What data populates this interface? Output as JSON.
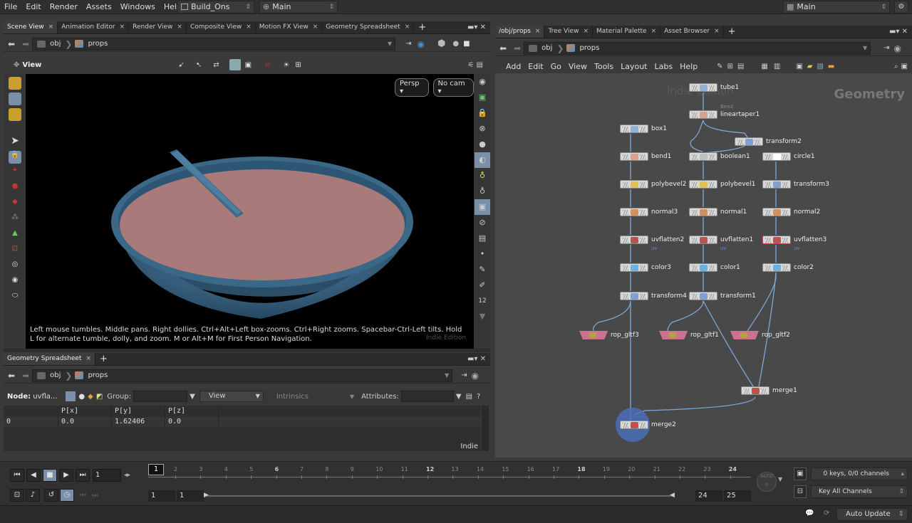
{
  "menubar": {
    "items": [
      "File",
      "Edit",
      "Render",
      "Assets",
      "Windows",
      "Help"
    ],
    "desktop": "Build_Ons",
    "context": "Main",
    "right_context": "Main"
  },
  "left_pane": {
    "tabs": [
      "Scene View",
      "Animation Editor",
      "Render View",
      "Composite View",
      "Motion FX View",
      "Geometry Spreadsheet"
    ],
    "path": [
      "obj",
      "props"
    ],
    "view_label": "View",
    "persp_button": "Persp",
    "cam_button": "No cam",
    "hint": "Left mouse tumbles. Middle pans. Right dollies. Ctrl+Alt+Left box-zooms. Ctrl+Right zooms. Spacebar-Ctrl-Left tilts. Hold L for alternate tumble, dolly, and zoom.     M or Alt+M for First Person Navigation.",
    "watermark": "Indie Edition"
  },
  "spreadsheet": {
    "tab": "Geometry Spreadsheet",
    "path": [
      "obj",
      "props"
    ],
    "node_label": "Node:",
    "node_value": "uvfla...",
    "group_label": "Group:",
    "view_label": "View",
    "intrinsics_label": "Intrinsics",
    "attributes_label": "Attributes:",
    "columns": [
      "",
      "P[x]",
      "P[y]",
      "P[z]"
    ],
    "rows": [
      [
        "0",
        "0.0",
        "1.62406",
        "0.0"
      ]
    ],
    "footer": "Indie"
  },
  "right_pane": {
    "tabs": [
      "/obj/props",
      "Tree View",
      "Material Palette",
      "Asset Browser"
    ],
    "path": [
      "obj",
      "props"
    ],
    "menu": [
      "Add",
      "Edit",
      "Go",
      "View",
      "Tools",
      "Layout",
      "Labs",
      "Help"
    ],
    "watermark": "Indie Edition",
    "context_label": "Geometry"
  },
  "network": {
    "nodes": [
      {
        "id": "tube1",
        "label": "tube1",
        "sub": "",
        "color": "#8fb0d8"
      },
      {
        "id": "lineartaper1",
        "label": "lineartaper1",
        "sub": "Bend",
        "color": "#d8a08f"
      },
      {
        "id": "transform2",
        "label": "transform2",
        "sub": "",
        "color": "#7fa0d0"
      },
      {
        "id": "box1",
        "label": "box1",
        "sub": "",
        "color": "#8fb0d8"
      },
      {
        "id": "bend1",
        "label": "bend1",
        "sub": "",
        "color": "#d8a08f"
      },
      {
        "id": "boolean1",
        "label": "boolean1",
        "sub": "",
        "color": "#c0c0c0"
      },
      {
        "id": "circle1",
        "label": "circle1",
        "sub": "",
        "color": "#ffffff"
      },
      {
        "id": "polybevel2",
        "label": "polybevel2",
        "sub": "",
        "color": "#e0c050"
      },
      {
        "id": "polybevel1",
        "label": "polybevel1",
        "sub": "",
        "color": "#e0c050"
      },
      {
        "id": "transform3",
        "label": "transform3",
        "sub": "",
        "color": "#7fa0d0"
      },
      {
        "id": "normal3",
        "label": "normal3",
        "sub": "",
        "color": "#d09060"
      },
      {
        "id": "normal1",
        "label": "normal1",
        "sub": "",
        "color": "#d09060"
      },
      {
        "id": "normal2",
        "label": "normal2",
        "sub": "",
        "color": "#d09060"
      },
      {
        "id": "uvflatten2",
        "label": "uvflatten2",
        "sub": "uv",
        "color": "#c05050"
      },
      {
        "id": "uvflatten1",
        "label": "uvflatten1",
        "sub": "uv",
        "color": "#c05050"
      },
      {
        "id": "uvflatten3",
        "label": "uvflatten3",
        "sub": "uv",
        "color": "#c05050"
      },
      {
        "id": "color3",
        "label": "color3",
        "sub": "",
        "color": "#70b0e0"
      },
      {
        "id": "color1",
        "label": "color1",
        "sub": "",
        "color": "#70b0e0"
      },
      {
        "id": "color2",
        "label": "color2",
        "sub": "",
        "color": "#70b0e0"
      },
      {
        "id": "transform4",
        "label": "transform4",
        "sub": "",
        "color": "#7fa0d0"
      },
      {
        "id": "transform1",
        "label": "transform1",
        "sub": "",
        "color": "#7fa0d0"
      },
      {
        "id": "rop_gltf3",
        "label": "rop_gltf3",
        "sub": "",
        "color": "#c9718e"
      },
      {
        "id": "rop_gltf1",
        "label": "rop_gltf1",
        "sub": "",
        "color": "#c9718e"
      },
      {
        "id": "rop_gltf2",
        "label": "rop_gltf2",
        "sub": "",
        "color": "#c9718e"
      },
      {
        "id": "merge1",
        "label": "merge1",
        "sub": "",
        "color": "#c05050"
      },
      {
        "id": "merge2",
        "label": "merge2",
        "sub": "",
        "color": "#c05050"
      }
    ]
  },
  "timeline": {
    "current_frame": "1",
    "frame_marker": "1",
    "ticks": [
      "2",
      "3",
      "4",
      "5",
      "6",
      "7",
      "8",
      "9",
      "10",
      "11",
      "12",
      "13",
      "14",
      "15",
      "16",
      "17",
      "18",
      "19",
      "20",
      "21",
      "22",
      "23",
      "24"
    ],
    "range_start": "1",
    "range_start2": "1",
    "range_end": "24",
    "range_end2": "25",
    "keys_label": "0 keys, 0/0 channels",
    "key_all": "Key All Channels",
    "auto_label": "AUTO"
  },
  "status": {
    "auto_update": "Auto Update"
  }
}
